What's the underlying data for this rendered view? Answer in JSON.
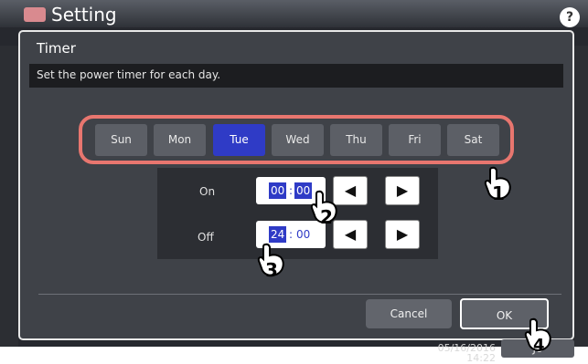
{
  "app": {
    "title": "Setting",
    "help_label": "?"
  },
  "dialog": {
    "title": "Timer",
    "hint": "Set the power timer for each day."
  },
  "days": [
    {
      "label": "Sun",
      "selected": false
    },
    {
      "label": "Mon",
      "selected": false
    },
    {
      "label": "Tue",
      "selected": true
    },
    {
      "label": "Wed",
      "selected": false
    },
    {
      "label": "Thu",
      "selected": false
    },
    {
      "label": "Fri",
      "selected": false
    },
    {
      "label": "Sat",
      "selected": false
    }
  ],
  "timer": {
    "on": {
      "label": "On",
      "hour": "00",
      "minute": "00"
    },
    "off": {
      "label": "Off",
      "hour": "24",
      "minute": "00"
    },
    "separator": ":",
    "left_arrow": "◀",
    "right_arrow": "▶"
  },
  "buttons": {
    "cancel": "Cancel",
    "ok": "OK"
  },
  "status": {
    "datetime": "05/16/2016\n14:22",
    "job_label": "Jo"
  },
  "steps": {
    "s1": "1",
    "s2": "2",
    "s3": "3",
    "s4": "4"
  },
  "colors": {
    "accent": "#2f3bc6",
    "highlight": "#e8766f",
    "bg": "#3f4248"
  }
}
